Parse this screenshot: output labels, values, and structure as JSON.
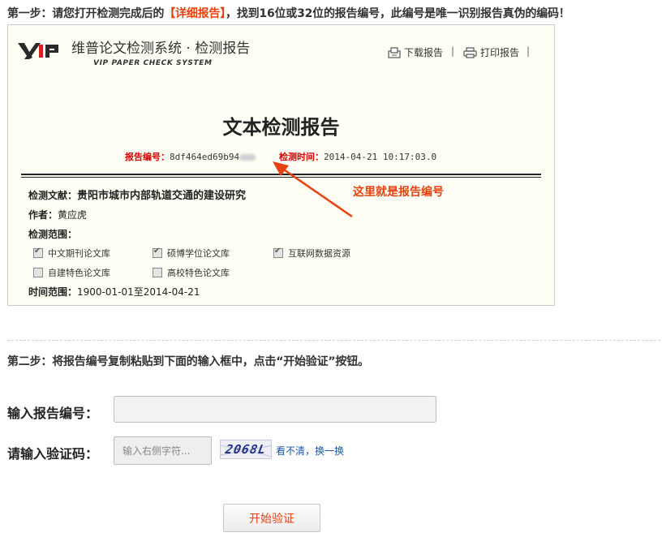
{
  "step1": {
    "prefix": "第一步：请您打开检测完成后的",
    "highlight": "【详细报告】",
    "suffix": "，找到16位或32位的报告编号，此编号是唯一识别报告真伪的编码！"
  },
  "report": {
    "logo_text": "VIP",
    "system_title": "维普论文检测系统 · 检测报告",
    "system_subtitle": "VIP PAPER CHECK SYSTEM",
    "download_label": "下载报告",
    "print_label": "打印报告",
    "separator": "|",
    "title": "文本检测报告",
    "report_no_label": "报告编号：",
    "report_no_value": "8df464ed69b94",
    "check_time_label": "检测时间：",
    "check_time_value": "2014-04-21 10:17:03.0",
    "doc_label": "检测文献：",
    "doc_value": "贵阳市城市内部轨道交通的建设研究",
    "author_label": "作者：",
    "author_value": "黄应虎",
    "scope_label": "检测范围：",
    "scope": [
      {
        "label": "中文期刊论文库",
        "checked": true
      },
      {
        "label": "硕博学位论文库",
        "checked": true
      },
      {
        "label": "互联网数据资源",
        "checked": true
      },
      {
        "label": "自建特色论文库",
        "checked": false
      },
      {
        "label": "高校特色论文库",
        "checked": false
      }
    ],
    "time_range_label": "时间范围：",
    "time_range_value": "1900-01-01至2014-04-21"
  },
  "callout": "这里就是报告编号",
  "step2": "第二步：将报告编号复制粘贴到下面的输入框中，点击“开始验证”按钮。",
  "form": {
    "report_no_label": "输入报告编号：",
    "report_no_value": "",
    "captcha_label": "请输入验证码：",
    "captcha_placeholder": "输入右侧字符...",
    "captcha_text": "2068L",
    "refresh_label": "看不清，换一换",
    "submit_label": "开始验证"
  },
  "colors": {
    "accent": "#e8410f",
    "red_label": "#d40000",
    "link": "#1a55a8"
  }
}
